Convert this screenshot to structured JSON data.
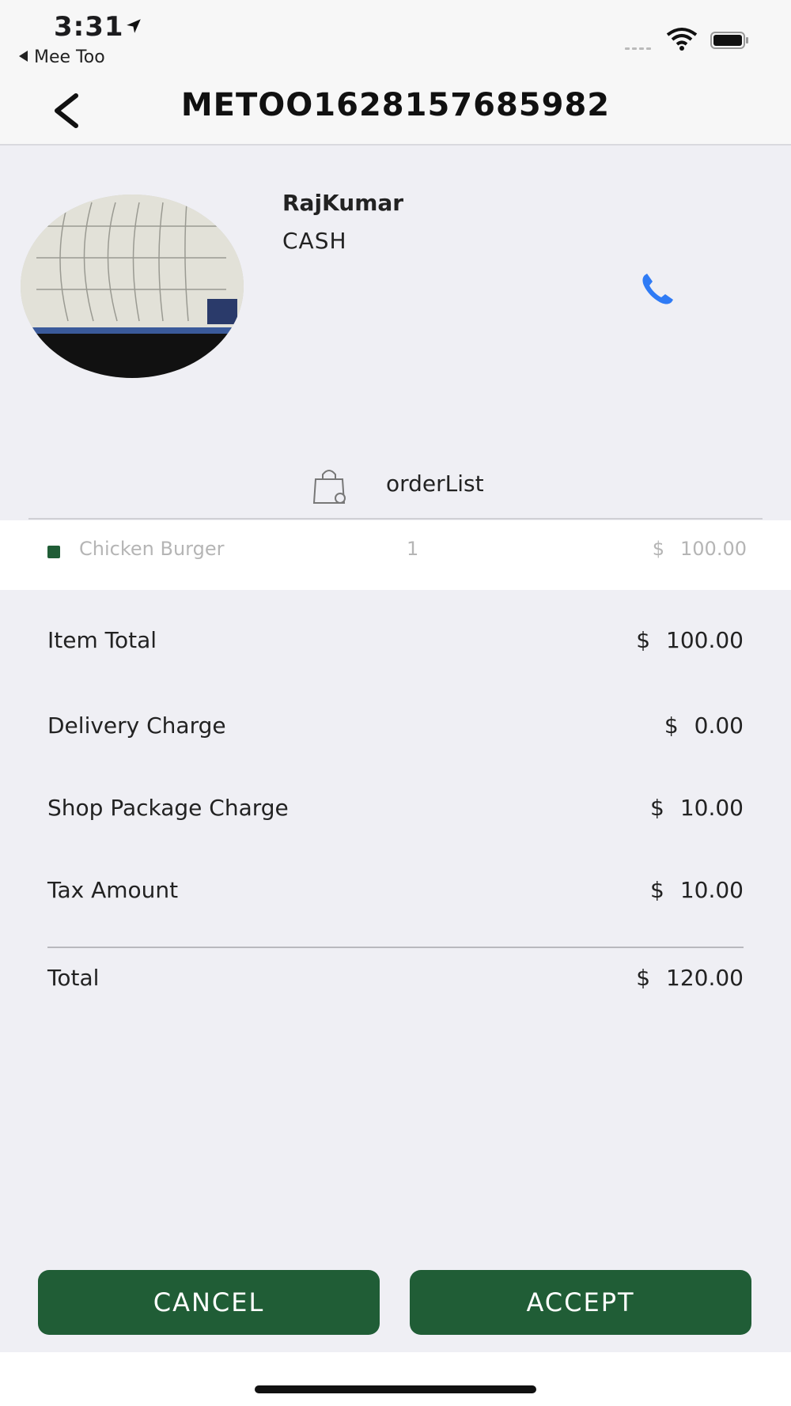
{
  "status_bar": {
    "time": "3:31",
    "back_app": "Mee Too"
  },
  "nav": {
    "title": "METOO1628157685982"
  },
  "customer": {
    "name": "RajKumar",
    "payment": "CASH"
  },
  "order_section": {
    "label": "orderList"
  },
  "items": [
    {
      "name": "Chicken Burger",
      "qty": "1",
      "currency": "$",
      "price": "100.00"
    }
  ],
  "summary": [
    {
      "label": "Item Total",
      "currency": "$",
      "value": "100.00"
    },
    {
      "label": "Delivery Charge",
      "currency": "$",
      "value": "0.00"
    },
    {
      "label": "Shop Package Charge",
      "currency": "$",
      "value": "10.00"
    },
    {
      "label": "Tax Amount",
      "currency": "$",
      "value": "10.00"
    }
  ],
  "total": {
    "label": "Total",
    "currency": "$",
    "value": "120.00"
  },
  "actions": {
    "cancel": "CANCEL",
    "accept": "ACCEPT"
  },
  "colors": {
    "primary": "#205d36",
    "phone_icon": "#2f7bf5",
    "background": "#efeff4"
  },
  "icons": {
    "back": "chevron-left-icon",
    "phone": "phone-icon",
    "order": "shopping-bag-icon",
    "location": "location-arrow-icon",
    "wifi": "wifi-icon",
    "battery": "battery-icon"
  }
}
